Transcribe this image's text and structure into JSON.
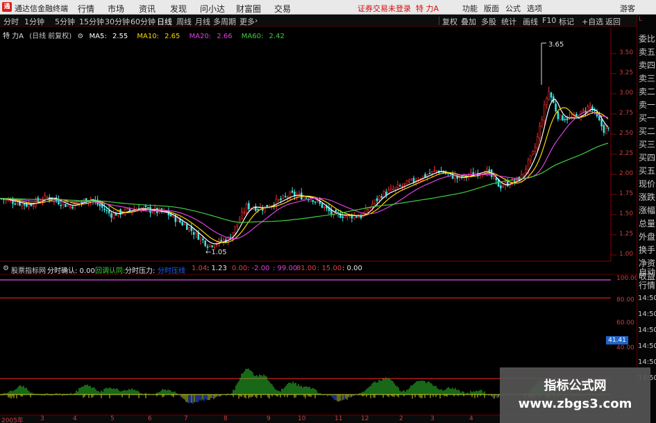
{
  "titlebar": {
    "app_title": "通达信金融终端",
    "menus": [
      "行情",
      "市场",
      "资讯",
      "发现",
      "问小达",
      "财富圈",
      "交易"
    ],
    "login_status": "证券交易未登录",
    "stock_name": "特 力A",
    "right_menus": [
      "功能",
      "版面",
      "公式",
      "选项"
    ],
    "guest": "游客"
  },
  "toolbar": {
    "periods": [
      "分时",
      "1分钟",
      "5分钟",
      "15分钟",
      "30分钟",
      "60分钟",
      "日线",
      "周线",
      "月线",
      "多周期",
      "更多"
    ],
    "active_period": "日线",
    "right_buttons": [
      "复权",
      "叠加",
      "多股",
      "统计",
      "画线",
      "F10",
      "标记",
      "+自选",
      "返回"
    ]
  },
  "main_chart": {
    "stock_label": "特 力A",
    "adjust_label": "(日线 前复权)",
    "ma": [
      {
        "label": "MA5:",
        "value": "2.55",
        "color": "#ffffff"
      },
      {
        "label": "MA10:",
        "value": "2.65",
        "color": "#ffd700"
      },
      {
        "label": "MA20:",
        "value": "2.66",
        "color": "#e040e0"
      },
      {
        "label": "MA60:",
        "value": "2.42",
        "color": "#40d040"
      }
    ],
    "y_ticks": [
      "3.50",
      "3.25",
      "3.00",
      "2.75",
      "2.50",
      "2.25",
      "2.00",
      "1.75",
      "1.50",
      "1.25",
      "1.00"
    ],
    "high_label": "3.65",
    "low_label": "1.05"
  },
  "indicator": {
    "name": "股票指标网",
    "items": [
      {
        "text": "分时确认: 0.00",
        "color": "#e8e8e8"
      },
      {
        "text": "回调认同:",
        "color": "#40d040"
      },
      {
        "text": "分时压力:",
        "color": "#e8e8e8"
      },
      {
        "text": "分时压线",
        "color": "#2060ff"
      },
      {
        "text": "1.04",
        "color": "#e04040"
      },
      {
        "text": ": 1.23",
        "color": "#e8e8e8"
      },
      {
        "text": "0.00",
        "color": "#e04040"
      },
      {
        "text": ": -2.00",
        "color": "#e040e0"
      },
      {
        "text": ": 99.00",
        "color": "#e040e0"
      },
      {
        "text": "81.00",
        "color": "#e04040"
      },
      {
        "text": ": 15.00",
        "color": "#e04040"
      },
      {
        "text": ": 0.00",
        "color": "#e8e8e8"
      }
    ],
    "y_ticks": [
      "100.00",
      "80.00",
      "60.00",
      "40.00"
    ],
    "flag_value": "41.41"
  },
  "date_axis": {
    "labels": [
      "2005年",
      "3",
      "4",
      "5",
      "6",
      "7",
      "8",
      "9",
      "10",
      "11",
      "12",
      "2",
      "3",
      "4"
    ]
  },
  "right_panel": {
    "top_label": "L",
    "items": [
      "委比",
      "卖五",
      "卖四",
      "卖三",
      "卖二",
      "卖一",
      "买一",
      "买二",
      "买三",
      "买四",
      "买五",
      "现价",
      "涨跌",
      "涨幅",
      "总量",
      "外盘",
      "换手",
      "净资",
      "收益",
      "自动",
      "行情"
    ],
    "times": [
      "14:50",
      "14:50",
      "14:50",
      "14:50",
      "14:50",
      "14:50"
    ]
  },
  "watermark": {
    "title": "指标公式网",
    "url": "www.zbgs3.com"
  }
}
